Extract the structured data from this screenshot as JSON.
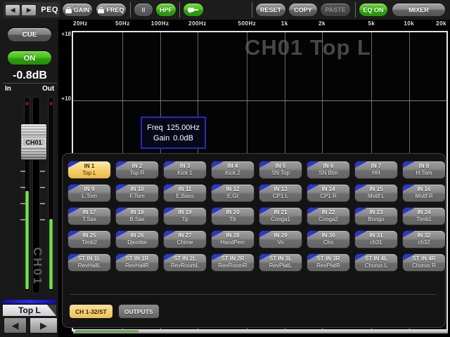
{
  "topbar": {
    "peq_label": "PEQ",
    "gain_label": "GAIN",
    "freq_label": "FREQ",
    "band_label": "II",
    "hpf_label": "HPF",
    "reset_label": "RESET",
    "copy_label": "COPY",
    "paste_label": "PASTE",
    "eq_on_label": "EQ ON",
    "mixer_label": "MIXER",
    "prev_arrow": "◀",
    "next_arrow": "▶"
  },
  "sidebar": {
    "cue_label": "CUE",
    "on_label": "ON",
    "gain_value": "-0.8dB",
    "meter_in_label": "In",
    "meter_out_label": "Out",
    "fader_channel": "CH01",
    "channel_watermark": "CH01",
    "channel_name": "Top L",
    "prev_arrow": "◀",
    "next_arrow": "▶"
  },
  "eq_graph": {
    "freq_labels": [
      "20Hz",
      "50Hz",
      "100Hz",
      "200Hz",
      "500Hz",
      "1k",
      "2k",
      "5k",
      "10k",
      "20k"
    ],
    "db_labels": [
      "+18",
      "+10"
    ],
    "watermark": "CH01 Top L",
    "tooltip": {
      "freq_param": "Freq",
      "freq_value": "125.00Hz",
      "gain_param": "Gain",
      "gain_value": "0.0dB"
    }
  },
  "channel_panel": {
    "channels": [
      {
        "id": "IN 1",
        "name": "Top L",
        "selected": true
      },
      {
        "id": "IN 2",
        "name": "Top R",
        "selected": false
      },
      {
        "id": "IN 3",
        "name": "Kick 1",
        "selected": false
      },
      {
        "id": "IN 4",
        "name": "Kick 2",
        "selected": false
      },
      {
        "id": "IN 5",
        "name": "SN Top",
        "selected": false
      },
      {
        "id": "IN 6",
        "name": "SN Btm",
        "selected": false
      },
      {
        "id": "IN 7",
        "name": "HH",
        "selected": false
      },
      {
        "id": "IN 8",
        "name": "H.Tom",
        "selected": false
      },
      {
        "id": "IN 9",
        "name": "L.Tom",
        "selected": false
      },
      {
        "id": "IN 10",
        "name": "F.Tom",
        "selected": false
      },
      {
        "id": "IN 11",
        "name": "E.Bass",
        "selected": false
      },
      {
        "id": "IN 12",
        "name": "E.Gt",
        "selected": false
      },
      {
        "id": "IN 13",
        "name": "CP1 L",
        "selected": false
      },
      {
        "id": "IN 14",
        "name": "CP1 R",
        "selected": false
      },
      {
        "id": "IN 15",
        "name": "Motif L",
        "selected": false
      },
      {
        "id": "IN 16",
        "name": "Motif R",
        "selected": false
      },
      {
        "id": "IN 17",
        "name": "T.Sax",
        "selected": false
      },
      {
        "id": "IN 18",
        "name": "B.Sax",
        "selected": false
      },
      {
        "id": "IN 19",
        "name": "Tp",
        "selected": false
      },
      {
        "id": "IN 20",
        "name": "Tb",
        "selected": false
      },
      {
        "id": "IN 21",
        "name": "Conga1",
        "selected": false
      },
      {
        "id": "IN 22",
        "name": "Conga2",
        "selected": false
      },
      {
        "id": "IN 23",
        "name": "Bongo",
        "selected": false
      },
      {
        "id": "IN 24",
        "name": "Timb1",
        "selected": false
      },
      {
        "id": "IN 25",
        "name": "Timb2",
        "selected": false
      },
      {
        "id": "IN 26",
        "name": "Djembe",
        "selected": false
      },
      {
        "id": "IN 27",
        "name": "Chime",
        "selected": false
      },
      {
        "id": "IN 28",
        "name": "HandPerc",
        "selected": false
      },
      {
        "id": "IN 29",
        "name": "Vo",
        "selected": false
      },
      {
        "id": "IN 30",
        "name": "Cho",
        "selected": false
      },
      {
        "id": "IN 31",
        "name": "ch31",
        "selected": false
      },
      {
        "id": "IN 32",
        "name": "ch32",
        "selected": false
      },
      {
        "id": "ST IN 1L",
        "name": "RevHallL",
        "selected": false
      },
      {
        "id": "ST IN 1R",
        "name": "RevHallR",
        "selected": false
      },
      {
        "id": "ST IN 2L",
        "name": "RevRoomL",
        "selected": false
      },
      {
        "id": "ST IN 2R",
        "name": "RevRoomR",
        "selected": false
      },
      {
        "id": "ST IN 3L",
        "name": "RevPlatL",
        "selected": false
      },
      {
        "id": "ST IN 3R",
        "name": "RevPlatR",
        "selected": false
      },
      {
        "id": "ST IN 4L",
        "name": "Chorus L",
        "selected": false
      },
      {
        "id": "ST IN 4R",
        "name": "Chorus R",
        "selected": false
      }
    ],
    "tabs": [
      {
        "label": "CH 1-32/ST",
        "selected": true
      },
      {
        "label": "OUTPUTS",
        "selected": false
      }
    ]
  },
  "colors": {
    "accent_green": "#49c01d",
    "selected_tan": "#f2c963",
    "channel_tab_blue": "#2737d2",
    "meter_green": "#55dd33",
    "tooltip_border_blue": "#2a2ab8",
    "name_bar_blue": "#2b2bee"
  }
}
